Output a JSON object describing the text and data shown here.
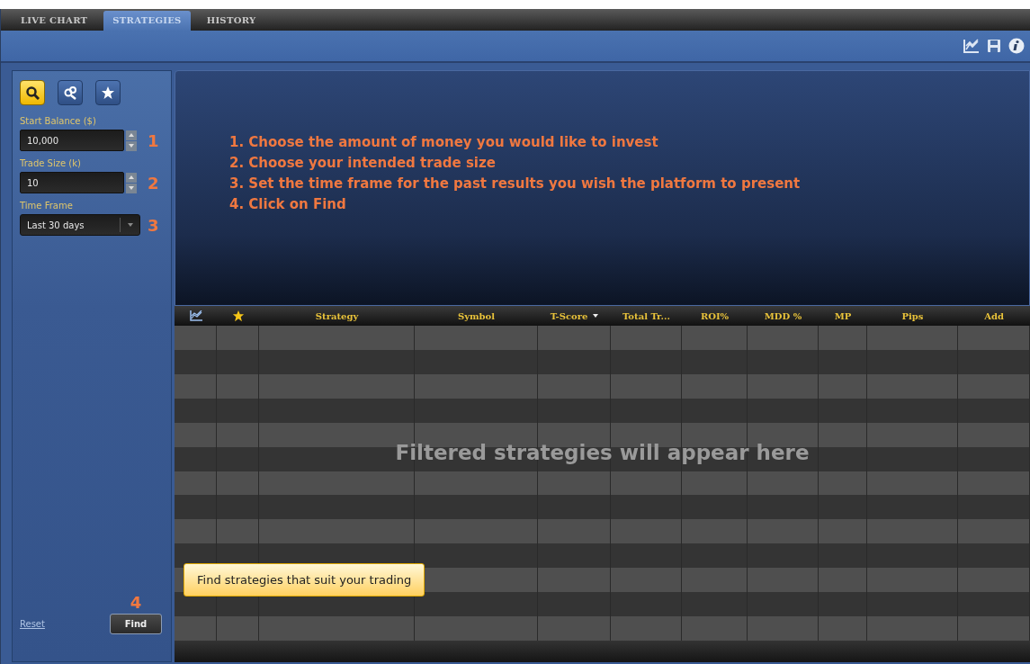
{
  "tabs": [
    {
      "label": "LIVE CHART",
      "selected": false
    },
    {
      "label": "STRATEGIES",
      "selected": true
    },
    {
      "label": "HISTORY",
      "selected": false
    }
  ],
  "mode_buttons": [
    {
      "kind": "search",
      "selected": true
    },
    {
      "kind": "people",
      "selected": false
    },
    {
      "kind": "star",
      "selected": false
    }
  ],
  "fields": [
    {
      "label": "Start Balance ($)",
      "value": "10,000",
      "kind": "spinner",
      "step": "1"
    },
    {
      "label": "Trade Size (k)",
      "value": "10",
      "kind": "spinner",
      "step": "2"
    },
    {
      "label": "Time Frame",
      "value": "Last 30 days",
      "kind": "dropdown",
      "step": "3"
    }
  ],
  "instructions": [
    "1. Choose the amount of money you would like to invest",
    "2. Choose your intended trade size",
    "3. Set the time frame for the past results you wish the platform to present",
    "4. Click on Find"
  ],
  "table": {
    "columns": [
      {
        "kind": "chart",
        "sorted": false
      },
      {
        "kind": "star",
        "sorted": false
      },
      {
        "kind": "text",
        "label": "Strategy",
        "sorted": false
      },
      {
        "kind": "text",
        "label": "Symbol",
        "sorted": false
      },
      {
        "kind": "text",
        "label": "T-Score",
        "sorted": true
      },
      {
        "kind": "text",
        "label": "Total Tr...",
        "sorted": false
      },
      {
        "kind": "text",
        "label": "ROI%",
        "sorted": false
      },
      {
        "kind": "text",
        "label": "MDD %",
        "sorted": false
      },
      {
        "kind": "text",
        "label": "MP",
        "sorted": false
      },
      {
        "kind": "text",
        "label": "Pips",
        "sorted": false
      },
      {
        "kind": "text",
        "label": "Add",
        "sorted": false
      }
    ],
    "empty_message": "Filtered strategies will appear here"
  },
  "find_step": "4",
  "reset_link": "Reset",
  "find_button": "Find",
  "tooltip": "Find strategies that suit your trading"
}
